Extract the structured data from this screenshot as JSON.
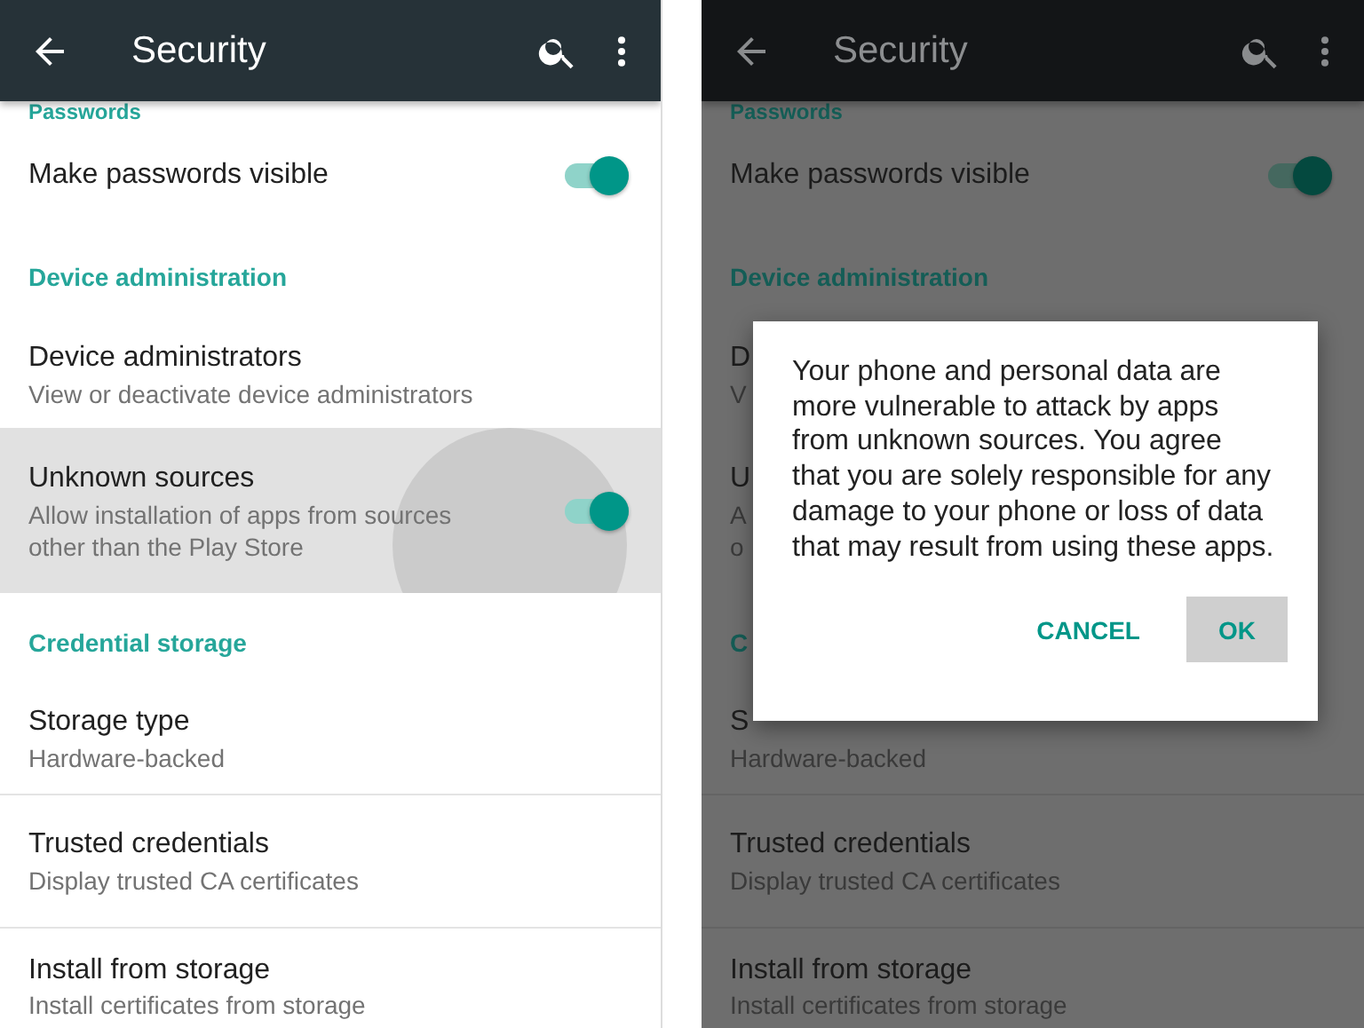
{
  "phones": [
    {
      "dimmed": false,
      "app_bar": {
        "title": "Security"
      },
      "items": [
        {
          "kind": "header",
          "title": "Passwords"
        },
        {
          "kind": "toggle",
          "title": "Make passwords visible",
          "on": true,
          "pressed": false
        },
        {
          "kind": "header",
          "title": "Device administration"
        },
        {
          "kind": "text",
          "title": "Device administrators",
          "summary": [
            "View or deactivate device administrators"
          ],
          "pressed": false
        },
        {
          "kind": "toggle",
          "title": "Unknown sources",
          "summary": [
            "Allow installation of apps from sources",
            "other than the Play Store"
          ],
          "on": true,
          "pressed": true
        },
        {
          "kind": "header",
          "title": "Credential storage"
        },
        {
          "kind": "text",
          "title": "Storage type",
          "summary": [
            "Hardware-backed"
          ],
          "pressed": false
        },
        {
          "kind": "text",
          "title": "Trusted credentials",
          "summary": [
            "Display trusted CA certificates"
          ],
          "pressed": false
        },
        {
          "kind": "text",
          "title": "Install from storage",
          "summary": [
            "Install certificates from storage"
          ],
          "pressed": false
        }
      ]
    },
    {
      "dimmed": true,
      "app_bar": {
        "title": "Security"
      },
      "items": [
        {
          "kind": "header",
          "title": "Passwords"
        },
        {
          "kind": "toggle",
          "title": "Make passwords visible",
          "on": true,
          "pressed": false
        },
        {
          "kind": "header",
          "title": "Device administration"
        },
        {
          "kind": "text",
          "title": "D",
          "summary": [
            "V"
          ],
          "pressed": false
        },
        {
          "kind": "text",
          "title": "U",
          "summary": [
            "A",
            "o"
          ],
          "pressed": false
        },
        {
          "kind": "header",
          "title": "C"
        },
        {
          "kind": "text",
          "title": "S",
          "summary": [
            "Hardware-backed"
          ],
          "pressed": false
        },
        {
          "kind": "text",
          "title": "Trusted credentials",
          "summary": [
            "Display trusted CA certificates"
          ],
          "pressed": false
        },
        {
          "kind": "text",
          "title": "Install from storage",
          "summary": [
            "Install certificates from storage"
          ],
          "pressed": false
        }
      ],
      "dialog": {
        "message": "Your phone and personal data are more vulnerable to attack by apps from unknown sources. You agree that you are solely responsible for any damage to your phone or loss of data that may result from using these apps.",
        "buttons": [
          {
            "label": "CANCEL",
            "pressed": false
          },
          {
            "label": "OK",
            "pressed": true
          }
        ]
      }
    }
  ]
}
